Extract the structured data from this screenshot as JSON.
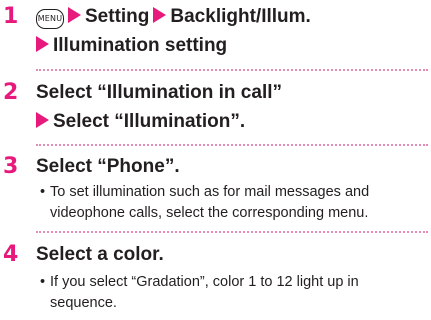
{
  "steps": [
    {
      "number": "1",
      "menu_key": "MENU",
      "line1": [
        "Setting",
        "Backlight/Illum."
      ],
      "line2": "Illumination setting"
    },
    {
      "number": "2",
      "line1": "Select “Illumination in call”",
      "line2": "Select “Illumination”."
    },
    {
      "number": "3",
      "line1": "Select “Phone”.",
      "note": {
        "bullet": "•",
        "text": "To set illumination such as for mail messages and videophone calls, select the corresponding menu."
      }
    },
    {
      "number": "4",
      "line1": "Select a color.",
      "note": {
        "bullet": "•",
        "text": "If you select “Gradation”, color 1 to 12 light up in sequence."
      }
    }
  ],
  "colors": {
    "accent": "#e8197d",
    "separator": "#e48bb8",
    "text": "#231f20"
  },
  "icons": {
    "arrow": "triangle-right-icon",
    "menu": "menu-key-icon"
  }
}
